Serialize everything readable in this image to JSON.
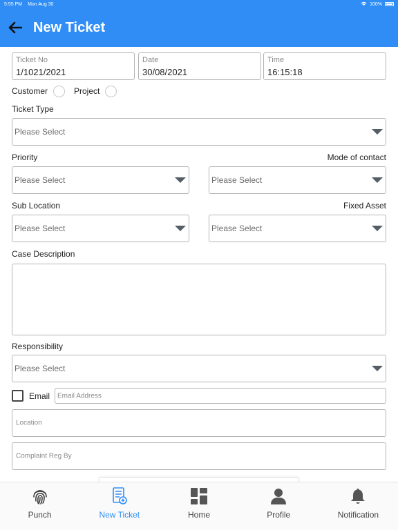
{
  "status_bar": {
    "time": "5:55 PM",
    "date": "Mon Aug 30",
    "battery": "100%"
  },
  "header": {
    "title": "New Ticket"
  },
  "form": {
    "ticket_no": {
      "label": "Ticket No",
      "value": "1/1021/2021"
    },
    "date": {
      "label": "Date",
      "value": "30/08/2021"
    },
    "time": {
      "label": "Time",
      "value": "16:15:18"
    },
    "customer_label": "Customer",
    "project_label": "Project",
    "ticket_type": {
      "label": "Ticket Type",
      "value": "Please Select"
    },
    "priority": {
      "label": "Priority",
      "value": "Please Select"
    },
    "mode_of_contact": {
      "label": "Mode of contact",
      "value": "Please Select"
    },
    "sub_location": {
      "label": "Sub Location",
      "value": "Please Select"
    },
    "fixed_asset": {
      "label": "Fixed Asset",
      "value": "Please Select"
    },
    "case_description": {
      "label": "Case Description",
      "value": ""
    },
    "responsibility": {
      "label": "Responsibility",
      "value": "Please Select"
    },
    "email": {
      "label": "Email",
      "placeholder": "Email Address"
    },
    "location": {
      "placeholder": "Location"
    },
    "complaint_reg_by": {
      "placeholder": "Complaint Reg By"
    }
  },
  "tabs": [
    {
      "label": "Punch",
      "icon": "fingerprint-icon"
    },
    {
      "label": "New Ticket",
      "icon": "new-ticket-icon"
    },
    {
      "label": "Home",
      "icon": "home-grid-icon"
    },
    {
      "label": "Profile",
      "icon": "profile-icon"
    },
    {
      "label": "Notification",
      "icon": "bell-icon"
    }
  ],
  "colors": {
    "primary": "#2f8df5",
    "active_tab": "#2f8df5",
    "text": "#222222",
    "border": "#b4b4b4"
  }
}
